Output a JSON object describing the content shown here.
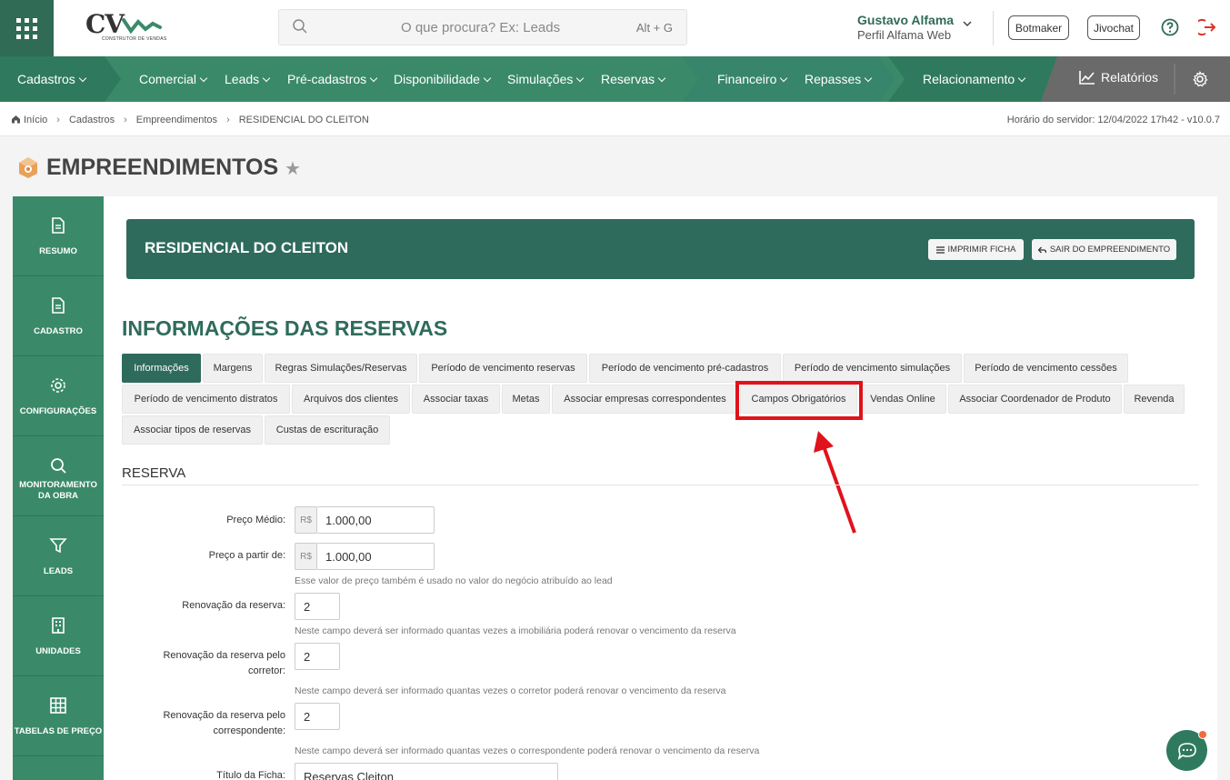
{
  "header": {
    "logo_text": "CV",
    "logo_sub": "CONSTRUTOR DE VENDAS",
    "search_placeholder": "O que procura? Ex: Leads",
    "search_shortcut": "Alt + G",
    "user_name": "Gustavo Alfama",
    "user_profile": "Perfil Alfama Web",
    "botmaker": "Botmaker",
    "jivochat": "Jivochat"
  },
  "nav": {
    "cadastros": "Cadastros",
    "comercial": "Comercial",
    "leads": "Leads",
    "pre_cadastros": "Pré-cadastros",
    "disponibilidade": "Disponibilidade",
    "simulacoes": "Simulações",
    "reservas": "Reservas",
    "financeiro": "Financeiro",
    "repasses": "Repasses",
    "relacionamento": "Relacionamento",
    "relatorios": "Relatórios",
    "colors": {
      "green": "#3a8a6a",
      "dark_green": "#2f6b55",
      "gray": "#6a6a6a"
    }
  },
  "breadcrumb": {
    "items": [
      "Início",
      "Cadastros",
      "Empreendimentos",
      "RESIDENCIAL DO CLEITON"
    ],
    "server_time": "Horário do servidor: 12/04/2022 17h42 - v10.0.7"
  },
  "page": {
    "title": "EMPREENDIMENTOS"
  },
  "sidebar": {
    "items": [
      {
        "label": "RESUMO"
      },
      {
        "label": "CADASTRO"
      },
      {
        "label": "CONFIGURAÇÕES"
      },
      {
        "label": "MONITORAMENTO DA OBRA"
      },
      {
        "label": "LEADS"
      },
      {
        "label": "UNIDADES"
      },
      {
        "label": "TABELAS DE PREÇO"
      }
    ]
  },
  "banner": {
    "title": "RESIDENCIAL DO CLEITON",
    "print_label": "IMPRIMIR FICHA",
    "exit_label": "SAIR DO EMPREENDIMENTO"
  },
  "section": {
    "title": "INFORMAÇÕES DAS RESERVAS"
  },
  "tabs": [
    "Informações",
    "Margens",
    "Regras Simulações/Reservas",
    "Período de vencimento reservas",
    "Período de vencimento pré-cadastros",
    "Período de vencimento simulações",
    "Período de vencimento cessões",
    "Período de vencimento distratos",
    "Arquivos dos clientes",
    "Associar taxas",
    "Metas",
    "Associar empresas correspondentes",
    "Campos Obrigatórios",
    "Vendas Online",
    "Associar Coordenador de Produto",
    "Revenda",
    "Associar tipos de reservas",
    "Custas de escrituração"
  ],
  "form": {
    "section": "RESERVA",
    "currency": "R$",
    "preco_medio_label": "Preço Médio:",
    "preco_medio_value": "1.000,00",
    "preco_partir_label": "Preço a partir de:",
    "preco_partir_value": "1.000,00",
    "preco_hint": "Esse valor de preço também é usado no valor do negócio atribuído ao lead",
    "renov_label": "Renovação da reserva:",
    "renov_value": "2",
    "renov_hint": "Neste campo deverá ser informado quantas vezes a imobiliária poderá renovar o vencimento da reserva",
    "renov_corretor_label_1": "Renovação da reserva pelo",
    "renov_corretor_label_2": "corretor:",
    "renov_corretor_value": "2",
    "renov_corretor_hint": "Neste campo deverá ser informado quantas vezes o corretor poderá renovar o vencimento da reserva",
    "renov_corresp_label_1": "Renovação da reserva pelo",
    "renov_corresp_label_2": "correspondente:",
    "renov_corresp_value": "2",
    "renov_corresp_hint": "Neste campo deverá ser informado quantas vezes o correspondente poderá renovar o vencimento da reserva",
    "titulo_label": "Título da Ficha:",
    "titulo_value": "Reservas Cleiton"
  }
}
